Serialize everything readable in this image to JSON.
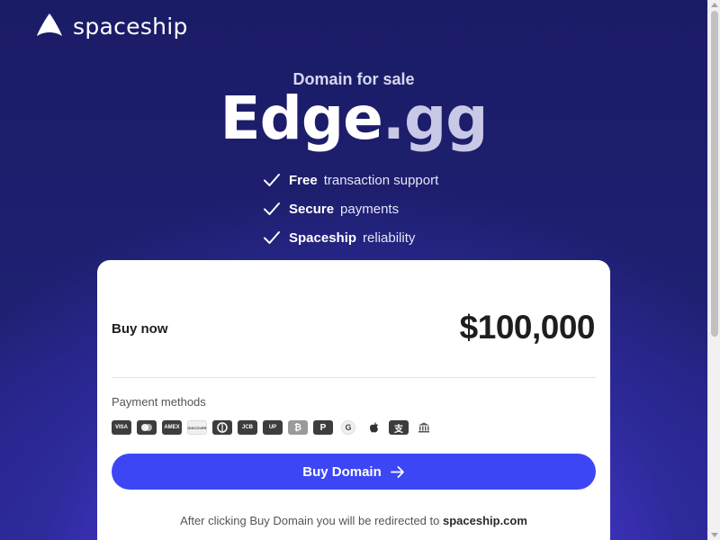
{
  "brand": {
    "name": "spaceship",
    "logo_icon": "spaceship-logo-icon"
  },
  "hero": {
    "subtitle": "Domain for sale",
    "domain_name": "Edge",
    "domain_tld": ".gg"
  },
  "features": [
    {
      "strong": "Free",
      "rest": "transaction support",
      "icon": "check-icon"
    },
    {
      "strong": "Secure",
      "rest": "payments",
      "icon": "check-icon"
    },
    {
      "strong": "Spaceship",
      "rest": "reliability",
      "icon": "check-icon"
    }
  ],
  "card": {
    "buy_now_label": "Buy now",
    "price": "$100,000",
    "payment_methods_label": "Payment methods",
    "payment_methods": [
      {
        "name": "visa",
        "label": "VISA"
      },
      {
        "name": "mastercard",
        "label": ""
      },
      {
        "name": "amex",
        "label": "AMEX"
      },
      {
        "name": "discover",
        "label": "DISCOVER"
      },
      {
        "name": "diners-club",
        "label": ""
      },
      {
        "name": "jcb",
        "label": "JCB"
      },
      {
        "name": "unionpay",
        "label": "UP"
      },
      {
        "name": "bitcoin",
        "label": "₿"
      },
      {
        "name": "paypal",
        "label": "P"
      },
      {
        "name": "google-pay",
        "label": "G"
      },
      {
        "name": "apple-pay",
        "label": ""
      },
      {
        "name": "alipay",
        "label": "支"
      },
      {
        "name": "bank-transfer",
        "label": "🏛"
      }
    ],
    "buy_button_label": "Buy Domain",
    "redirect_text": "After clicking Buy Domain you will be redirected to",
    "redirect_site": "spaceship.com"
  },
  "colors": {
    "background": "#1d1d6b",
    "accent": "#3d46f5",
    "glow": "#6a43f0"
  }
}
